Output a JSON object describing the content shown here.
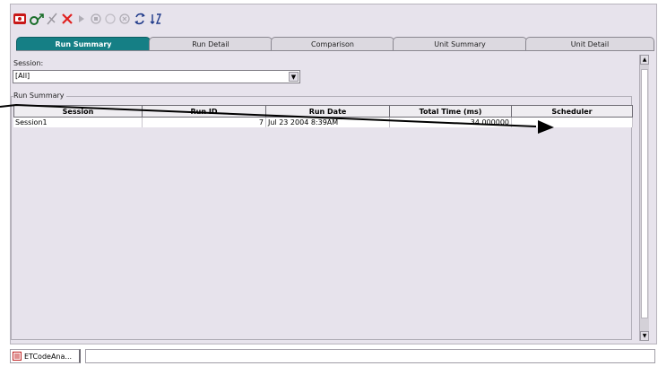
{
  "tabs": [
    {
      "label": "Run Summary",
      "active": true
    },
    {
      "label": "Run Detail"
    },
    {
      "label": "Comparison"
    },
    {
      "label": "Unit Summary"
    },
    {
      "label": "Unit Detail"
    }
  ],
  "session": {
    "label": "Session:",
    "value": "[All]",
    "dropdown_icon": "chevron-down-icon"
  },
  "group": {
    "label": "Run Summary"
  },
  "grid": {
    "columns": [
      "Session",
      "Run ID",
      "Run Date",
      "Total Time (ms)",
      "Scheduler"
    ],
    "rows": [
      [
        "Session1",
        "7",
        "Jul 23 2004  8:39AM",
        "34.000000",
        ""
      ]
    ]
  },
  "toolbar": {
    "icons": [
      "record-icon",
      "connect-icon",
      "disconnect-icon",
      "delete-icon",
      "play-icon",
      "stop-icon",
      "pause-icon",
      "cancel-icon",
      "refresh-icon",
      "sort-icon"
    ]
  },
  "statusbar": {
    "task_label": "ETCodeAna..."
  },
  "colors": {
    "active_tab": "#157f85",
    "panel": "#e7e3ec",
    "delete": "#e02020"
  }
}
